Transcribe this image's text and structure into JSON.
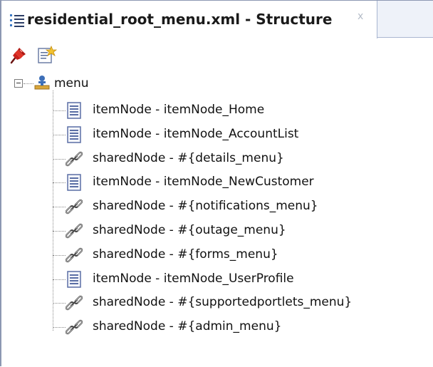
{
  "tab": {
    "title": "residential_root_menu.xml - Structure",
    "close_glyph": "x",
    "icon": "structure-icon"
  },
  "toolbar": {
    "buttons": [
      {
        "icon": "pin-icon",
        "color": "#d9261c"
      },
      {
        "icon": "properties-icon"
      }
    ]
  },
  "tree": {
    "root": {
      "label": "menu",
      "icon": "menu-root-icon",
      "expanded": true
    },
    "children": [
      {
        "type": "itemNode",
        "label": "itemNode - itemNode_Home",
        "icon": "item-node-icon"
      },
      {
        "type": "itemNode",
        "label": "itemNode - itemNode_AccountList",
        "icon": "item-node-icon"
      },
      {
        "type": "sharedNode",
        "label": "sharedNode - #{details_menu}",
        "icon": "shared-node-icon"
      },
      {
        "type": "itemNode",
        "label": "itemNode - itemNode_NewCustomer",
        "icon": "item-node-icon"
      },
      {
        "type": "sharedNode",
        "label": "sharedNode - #{notifications_menu}",
        "icon": "shared-node-icon"
      },
      {
        "type": "sharedNode",
        "label": "sharedNode - #{outage_menu}",
        "icon": "shared-node-icon"
      },
      {
        "type": "sharedNode",
        "label": "sharedNode - #{forms_menu}",
        "icon": "shared-node-icon"
      },
      {
        "type": "itemNode",
        "label": "itemNode - itemNode_UserProfile",
        "icon": "item-node-icon"
      },
      {
        "type": "sharedNode",
        "label": "sharedNode - #{supportedportlets_menu}",
        "icon": "shared-node-icon"
      },
      {
        "type": "sharedNode",
        "label": "sharedNode - #{admin_menu}",
        "icon": "shared-node-icon"
      }
    ]
  }
}
